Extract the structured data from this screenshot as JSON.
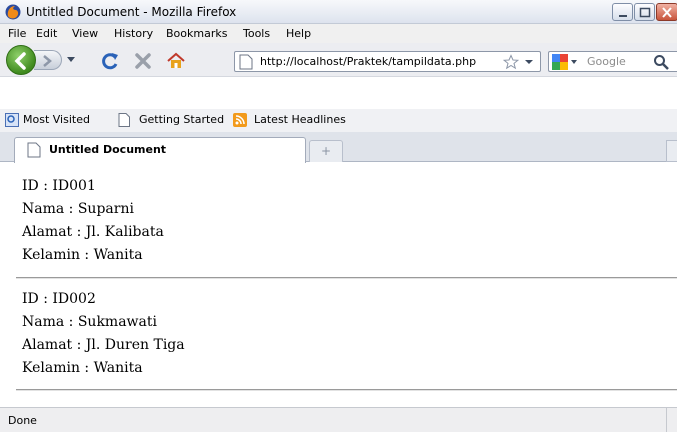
{
  "window": {
    "title": "Untitled Document - Mozilla Firefox"
  },
  "menu": {
    "items": [
      "File",
      "Edit",
      "View",
      "History",
      "Bookmarks",
      "Tools",
      "Help"
    ]
  },
  "navigation": {
    "url": "http://localhost/Praktek/tampildata.php",
    "search_placeholder": "Google"
  },
  "bookmarks": {
    "items": [
      "Most Visited",
      "Getting Started",
      "Latest Headlines"
    ]
  },
  "tabs": {
    "active_label": "Untitled Document",
    "new_tab_symbol": "+"
  },
  "records": [
    {
      "id_line": "ID : ID001",
      "nama_line": "Nama : Suparni",
      "alamat_line": "Alamat : Jl. Kalibata",
      "kelamin_line": "Kelamin : Wanita"
    },
    {
      "id_line": "ID : ID002",
      "nama_line": "Nama : Sukmawati",
      "alamat_line": "Alamat : Jl. Duren Tiga",
      "kelamin_line": "Kelamin : Wanita"
    }
  ],
  "status": {
    "text": "Done"
  },
  "colors": {
    "back_button": "#3f8a1e",
    "reload_icon": "#2a62b8",
    "stop_icon": "#9aa0aa",
    "home_icon": "#e8a21c",
    "rss_icon": "#f29a1b"
  }
}
